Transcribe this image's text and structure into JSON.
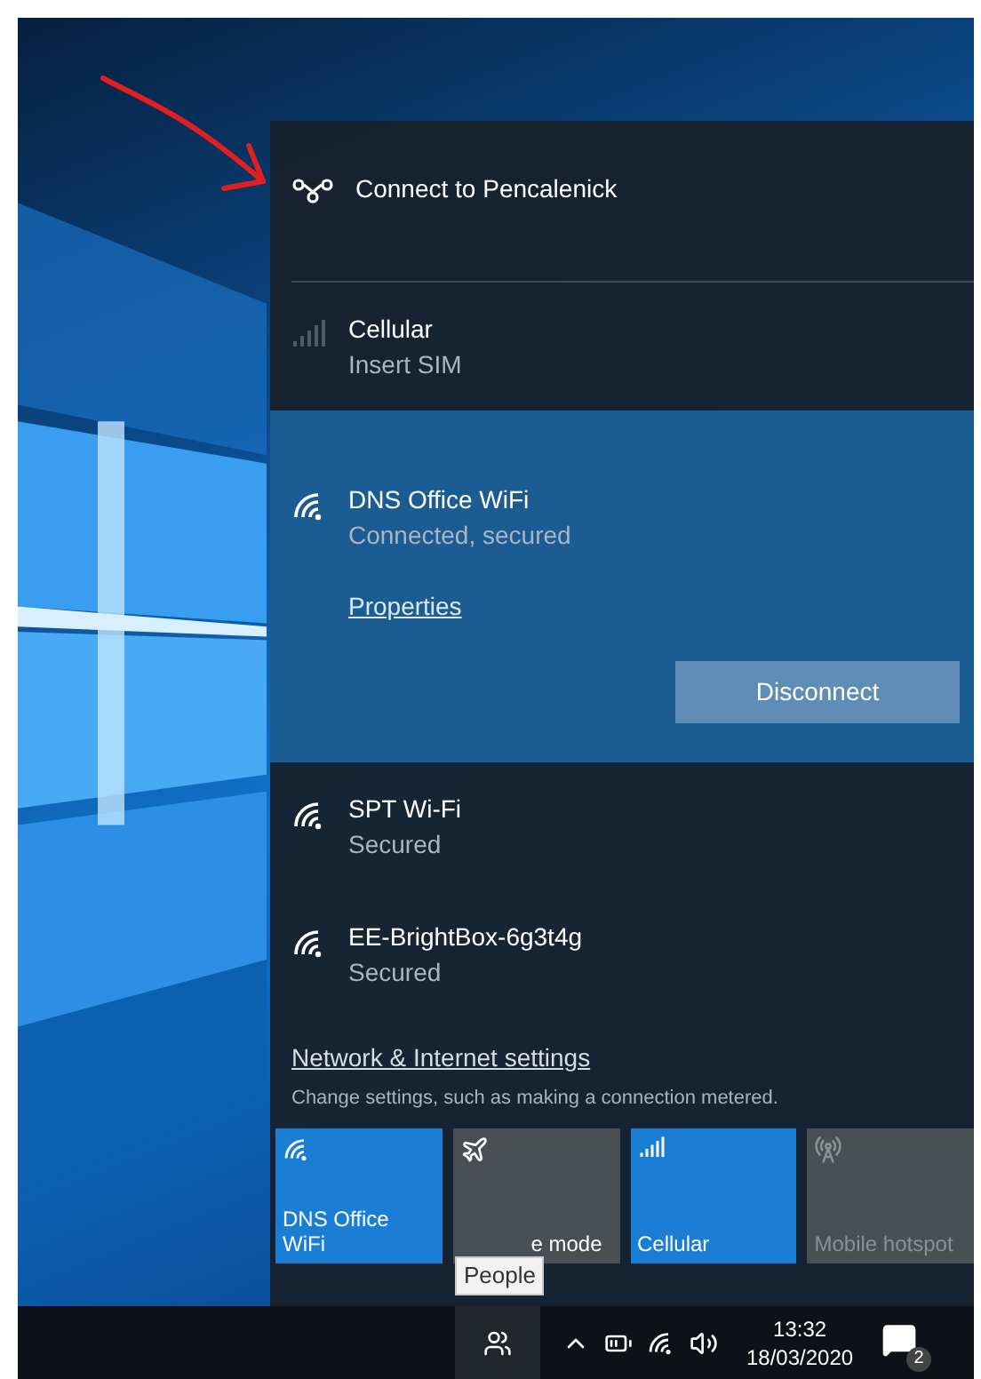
{
  "connect_prompt": {
    "label": "Connect to Pencalenick"
  },
  "networks": [
    {
      "kind": "cellular",
      "name": "Cellular",
      "status": "Insert SIM",
      "selected": false
    },
    {
      "kind": "wifi",
      "name": "DNS Office WiFi",
      "status": "Connected, secured",
      "selected": true,
      "link": "Properties",
      "button": "Disconnect"
    },
    {
      "kind": "wifi",
      "name": "SPT Wi-Fi",
      "status": "Secured",
      "selected": false
    },
    {
      "kind": "wifi",
      "name": "EE-BrightBox-6g3t4g",
      "status": "Secured",
      "selected": false
    }
  ],
  "settings": {
    "link": "Network & Internet settings",
    "description": "Change settings, such as making a connection metered."
  },
  "quick_actions": [
    {
      "kind": "wifi",
      "label": "DNS Office WiFi",
      "on": true,
      "disabled": false
    },
    {
      "kind": "airplane",
      "label": "e mode",
      "on": false,
      "disabled": false
    },
    {
      "kind": "cellular",
      "label": "Cellular",
      "on": true,
      "disabled": false
    },
    {
      "kind": "hotspot",
      "label": "Mobile hotspot",
      "on": false,
      "disabled": true
    }
  ],
  "tooltip": {
    "text": "People"
  },
  "taskbar": {
    "time": "13:32",
    "date": "18/03/2020",
    "notification_count": "2"
  }
}
